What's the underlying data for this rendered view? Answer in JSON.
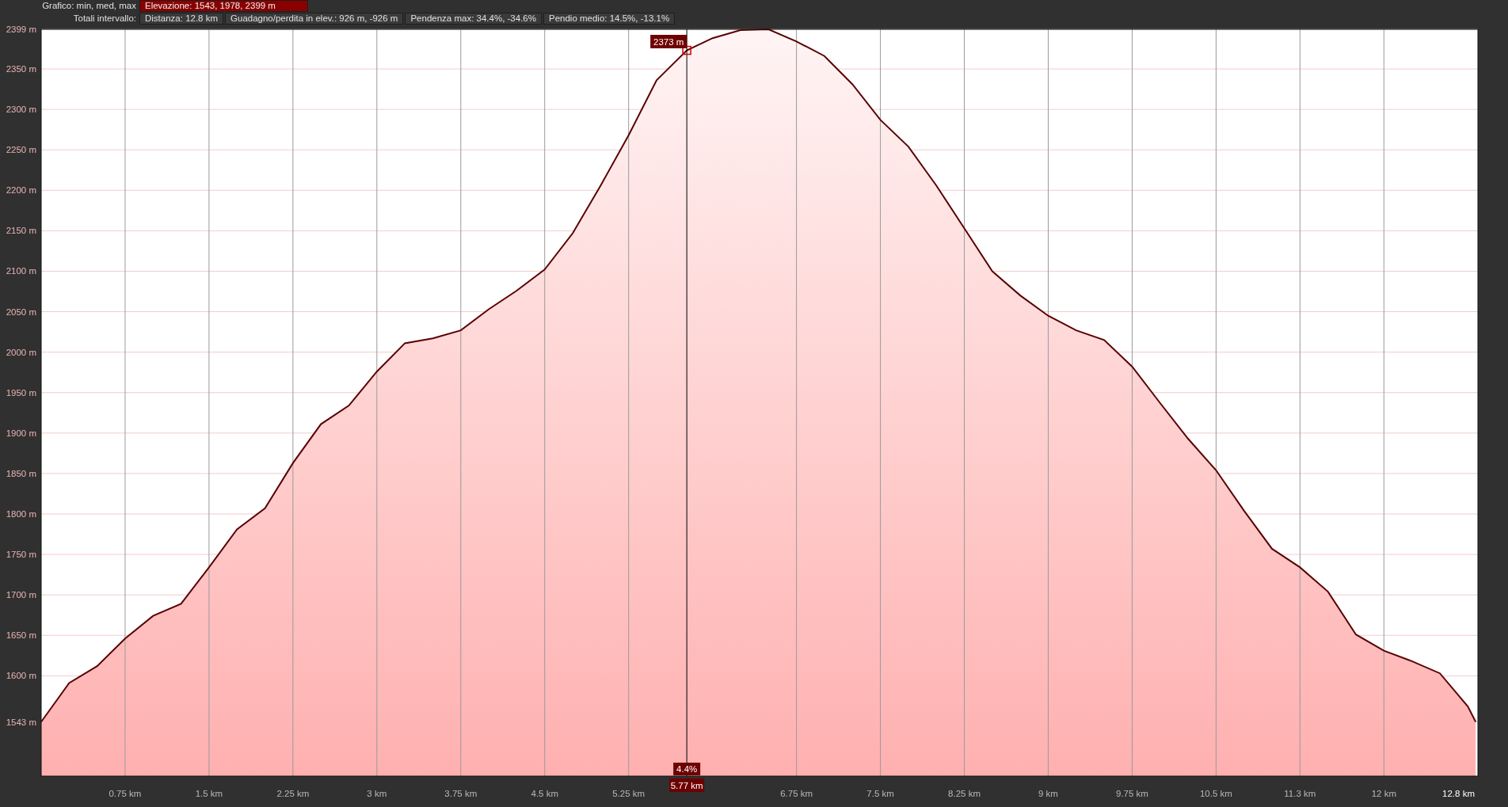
{
  "header": {
    "rows": [
      {
        "label": "Grafico: min, med, max",
        "cells": [
          {
            "text": "Elevazione: 1543, 1978, 2399 m",
            "kind": "highlight"
          }
        ]
      },
      {
        "label": "Totali intervallo:",
        "cells": [
          {
            "text": "Distanza: 12.8 km",
            "kind": "plain"
          },
          {
            "text": "Guadagno/perdita in elev.: 926 m, -926 m",
            "kind": "plain"
          },
          {
            "text": "Pendenza max: 34.4%, -34.6%",
            "kind": "plain"
          },
          {
            "text": "Pendio medio: 14.5%, -13.1%",
            "kind": "plain"
          }
        ]
      }
    ]
  },
  "chart": {
    "chart_data": {
      "type": "area",
      "x": [
        0,
        0.25,
        0.5,
        0.75,
        1,
        1.25,
        1.5,
        1.75,
        2,
        2.25,
        2.5,
        2.75,
        3,
        3.25,
        3.5,
        3.75,
        4,
        4.25,
        4.5,
        4.75,
        5,
        5.25,
        5.5,
        5.77,
        6,
        6.25,
        6.5,
        6.75,
        7,
        7.25,
        7.5,
        7.75,
        8,
        8.25,
        8.5,
        8.75,
        9,
        9.25,
        9.5,
        9.75,
        10,
        10.25,
        10.5,
        10.75,
        11,
        11.25,
        11.5,
        11.75,
        12,
        12.25,
        12.5,
        12.75,
        12.82
      ],
      "series": [
        {
          "color": "#5a0000",
          "values": [
            1543,
            1591,
            1612,
            1646,
            1674,
            1689,
            1734,
            1781,
            1807,
            1863,
            1911,
            1934,
            1976,
            2011,
            2017,
            2027,
            2053,
            2076,
            2102,
            2147,
            2206,
            2268,
            2336,
            2373,
            2388,
            2398,
            2399,
            2384,
            2366,
            2331,
            2287,
            2254,
            2206,
            2153,
            2100,
            2070,
            2045,
            2027,
            2015,
            1982,
            1937,
            1893,
            1854,
            1804,
            1757,
            1734,
            1704,
            1651,
            1631,
            1618,
            1603,
            1562,
            1543
          ]
        }
      ],
      "xlim": [
        0,
        12.84
      ],
      "ylim": [
        1476,
        2399
      ],
      "grid": true,
      "ref_lines": [
        {
          "axis": "x",
          "value": 5.77,
          "color": "#000000"
        }
      ],
      "xticks": [
        {
          "value": 0.75,
          "label": "0.75 km"
        },
        {
          "value": 1.5,
          "label": "1.5 km"
        },
        {
          "value": 2.25,
          "label": "2.25 km"
        },
        {
          "value": 3,
          "label": "3 km"
        },
        {
          "value": 3.75,
          "label": "3.75 km"
        },
        {
          "value": 4.5,
          "label": "4.5 km"
        },
        {
          "value": 5.25,
          "label": "5.25 km"
        },
        {
          "value": 6.75,
          "label": "6.75 km"
        },
        {
          "value": 7.5,
          "label": "7.5 km"
        },
        {
          "value": 8.25,
          "label": "8.25 km"
        },
        {
          "value": 9,
          "label": "9 km"
        },
        {
          "value": 9.75,
          "label": "9.75 km"
        },
        {
          "value": 10.5,
          "label": "10.5 km"
        },
        {
          "value": 11.25,
          "label": "11.3 km"
        },
        {
          "value": 12,
          "label": "12 km"
        },
        {
          "value": 12.8,
          "label": "12.8 km"
        }
      ],
      "yticks": [
        {
          "value": 1543,
          "label": "1543 m"
        },
        {
          "value": 1600,
          "label": "1600 m"
        },
        {
          "value": 1650,
          "label": "1650 m"
        },
        {
          "value": 1700,
          "label": "1700 m"
        },
        {
          "value": 1750,
          "label": "1750 m"
        },
        {
          "value": 1800,
          "label": "1800 m"
        },
        {
          "value": 1850,
          "label": "1850 m"
        },
        {
          "value": 1900,
          "label": "1900 m"
        },
        {
          "value": 1950,
          "label": "1950 m"
        },
        {
          "value": 2000,
          "label": "2000 m"
        },
        {
          "value": 2050,
          "label": "2050 m"
        },
        {
          "value": 2100,
          "label": "2100 m"
        },
        {
          "value": 2150,
          "label": "2150 m"
        },
        {
          "value": 2200,
          "label": "2200 m"
        },
        {
          "value": 2250,
          "label": "2250 m"
        },
        {
          "value": 2300,
          "label": "2300 m"
        },
        {
          "value": 2350,
          "label": "2350 m"
        },
        {
          "value": 2399,
          "label": "2399 m"
        }
      ]
    },
    "cursor": {
      "elevation": "2373 m",
      "slope": "4.4%",
      "distance": "5.77 km"
    }
  }
}
